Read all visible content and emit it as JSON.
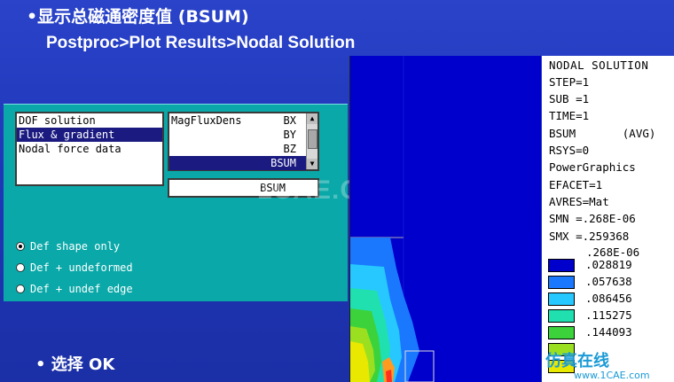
{
  "heading": "•显示总磁通密度值 (BSUM)",
  "menu_path": "Postproc>Plot Results>Nodal Solution",
  "instruction": "•  选择 OK",
  "watermark": "1CAE.COM",
  "dialog": {
    "item_list": [
      "DOF solution",
      "Flux & gradient",
      "Nodal force data"
    ],
    "item_selected_index": 1,
    "category": "MagFluxDens",
    "components": [
      "BX",
      "BY",
      "BZ",
      "BSUM"
    ],
    "component_selected_index": 3,
    "selected_field": "BSUM",
    "radio_options": [
      "Def shape only",
      "Def + undeformed",
      "Def + undef edge"
    ],
    "radio_selected_index": 0
  },
  "legend": {
    "lines": [
      "NODAL SOLUTION",
      "STEP=1",
      "SUB =1",
      "TIME=1",
      "BSUM       (AVG)",
      "RSYS=0",
      "PowerGraphics",
      "EFACET=1",
      "AVRES=Mat",
      "SMN =.268E-06",
      "SMX =.259368"
    ],
    "levels": [
      ".268E-06",
      ".028819",
      ".057638",
      ".086456",
      ".115275",
      ".144093"
    ],
    "colors": [
      "#0000cc",
      "#1a78ff",
      "#26c8ff",
      "#20e0b0",
      "#3cd23c",
      "#9be020",
      "#e8e800"
    ]
  },
  "brand": {
    "name": "仿真在线",
    "url": "www.1CAE.com"
  },
  "colors": {
    "slide_background": "#1f36b8",
    "dialog_background": "#0aa8a8",
    "selection": "#1a1a80"
  }
}
